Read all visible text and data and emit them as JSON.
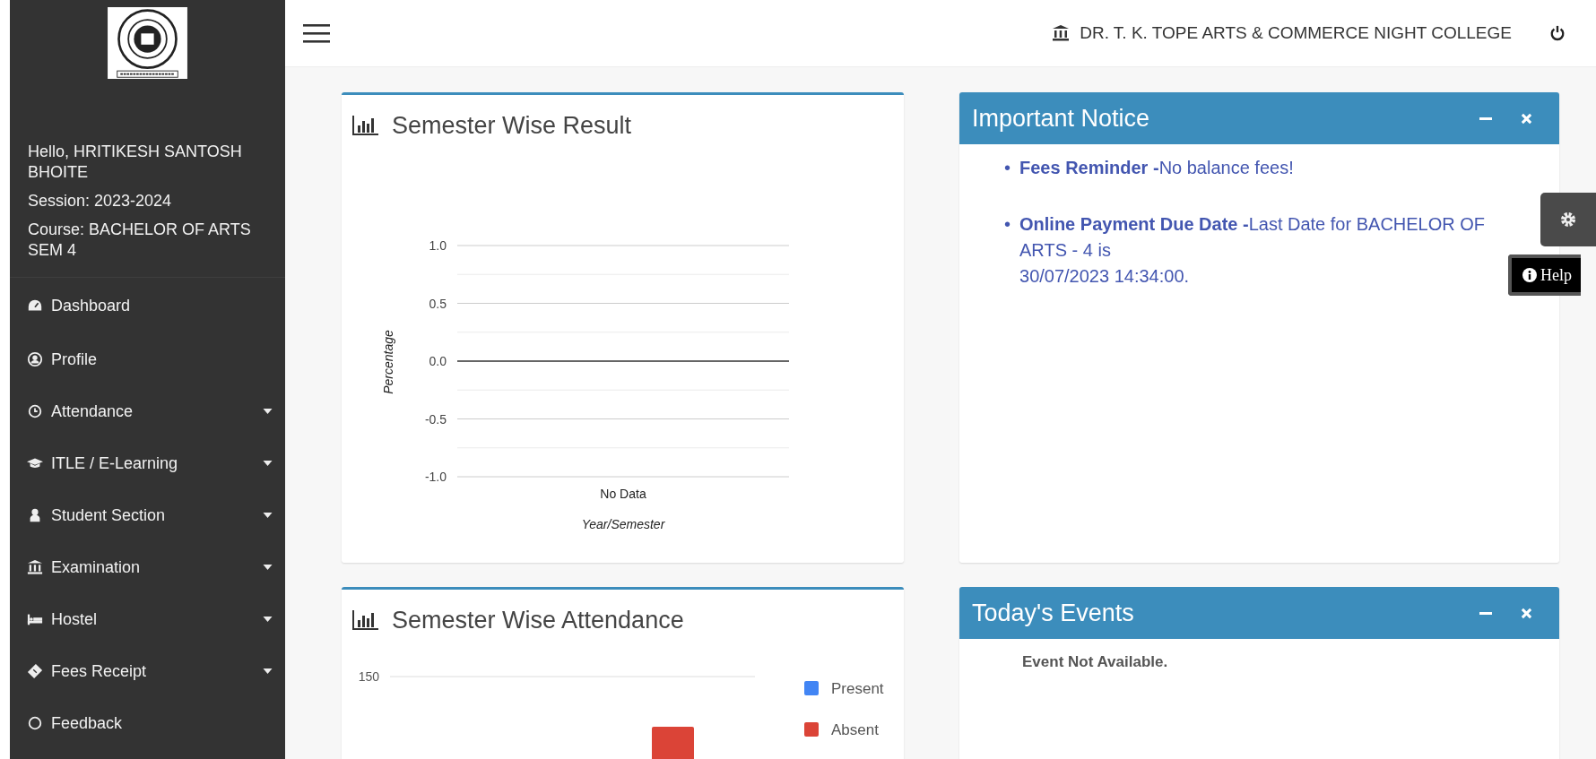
{
  "sidebar": {
    "greeting": "Hello, HRITIKESH SANTOSH BHOITE",
    "session": "Session: 2023-2024",
    "course": "Course: BACHELOR OF ARTS SEM 4",
    "items": [
      {
        "label": "Dashboard",
        "dropdown": false
      },
      {
        "label": "Profile",
        "dropdown": false
      },
      {
        "label": "Attendance",
        "dropdown": true
      },
      {
        "label": "ITLE / E-Learning",
        "dropdown": true
      },
      {
        "label": "Student Section",
        "dropdown": true
      },
      {
        "label": "Examination",
        "dropdown": true
      },
      {
        "label": "Hostel",
        "dropdown": true
      },
      {
        "label": "Fees Receipt",
        "dropdown": true
      },
      {
        "label": "Feedback",
        "dropdown": false
      }
    ]
  },
  "header": {
    "college_name": "DR. T. K. TOPE ARTS & COMMERCE NIGHT COLLEGE"
  },
  "result_card": {
    "title": "Semester Wise Result",
    "chart_data": {
      "type": "line",
      "xlabel": "Year/Semester",
      "ylabel": "Percentage",
      "categories": [
        "No Data"
      ],
      "ylim": [
        -1,
        1
      ],
      "yticks": [
        {
          "value": -1,
          "label": "-1.0"
        },
        {
          "value": -0.5,
          "label": "-0.5"
        },
        {
          "value": 0,
          "label": "0.0"
        },
        {
          "value": 0.5,
          "label": "0.5"
        },
        {
          "value": 1,
          "label": "1.0"
        }
      ]
    }
  },
  "notice_card": {
    "title": "Important Notice",
    "items": [
      {
        "bullet": "•",
        "text": "**Fees Reminder -**No balance fees!"
      },
      {
        "bullet": "•",
        "text": "**Online Payment Due Date -**Last Date for BACHELOR OF ARTS - 4 is\n30/07/2023 14:34:00."
      }
    ]
  },
  "attendance_card": {
    "title": "Semester Wise Attendance",
    "tick": "150",
    "legend": [
      {
        "label": "Present",
        "color": "#4285f4"
      },
      {
        "label": "Absent",
        "color": "#db4437"
      }
    ]
  },
  "events_card": {
    "title": "Today's Events",
    "message": "Event Not Available."
  },
  "help_button": {
    "label": "Help"
  }
}
